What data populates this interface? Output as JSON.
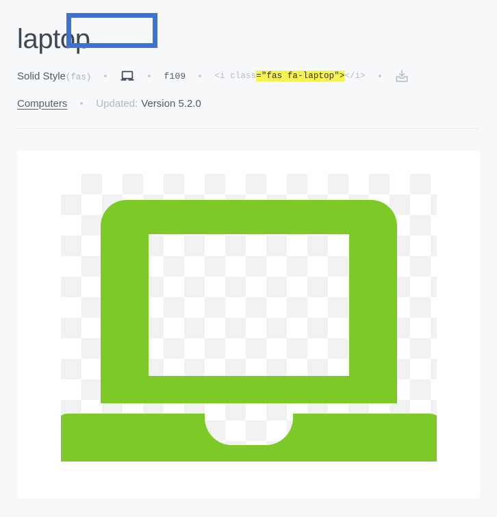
{
  "page": {
    "title": "laptop",
    "background_color": "#f7f8fa"
  },
  "meta": {
    "style_label": "Solid Style",
    "style_abbr": "(fas)",
    "glyph_icon": "laptop-icon",
    "unicode": "f109",
    "code": {
      "prefix": "<i class",
      "highlighted": "=\"fas fa-laptop\">",
      "suffix": "</i>"
    },
    "download_icon": "download-icon",
    "separator": "•"
  },
  "meta2": {
    "category": "Computers",
    "updated_label": "Updated:",
    "updated_version": "Version 5.2.0"
  },
  "selection": {
    "border_color": "#3b73d4",
    "highlight_color": "#f6f24e"
  },
  "preview": {
    "icon_name": "laptop-icon-large",
    "icon_color": "#7dc927",
    "checker_light": "#ffffff",
    "checker_dark": "#f2f2f2"
  }
}
